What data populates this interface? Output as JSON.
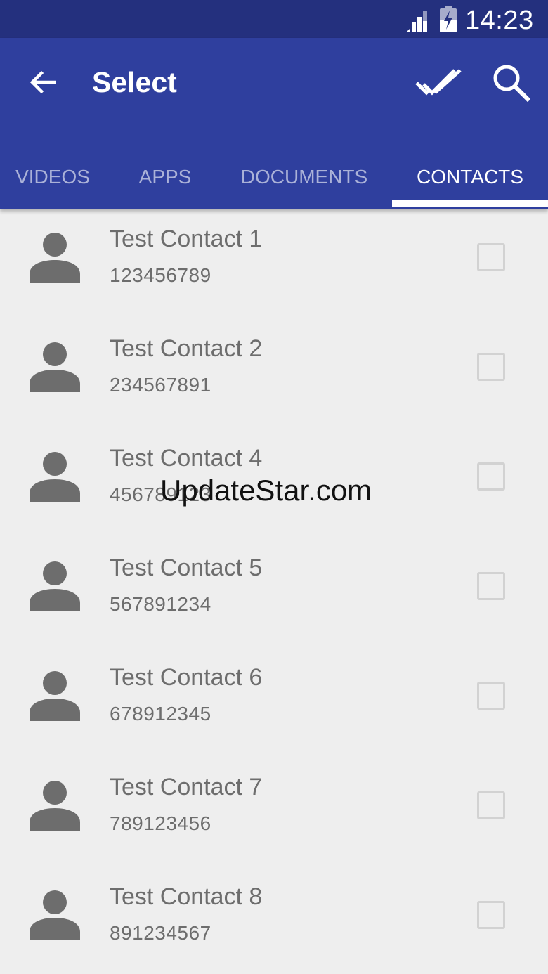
{
  "status_bar": {
    "time": "14:23",
    "icons": [
      "signal-icon",
      "battery-charging-icon"
    ]
  },
  "app_bar": {
    "title": "Select",
    "icons": [
      "back-arrow-icon",
      "select-all-icon",
      "search-icon"
    ]
  },
  "tabs": [
    {
      "label": "VIDEOS",
      "active": false
    },
    {
      "label": "APPS",
      "active": false
    },
    {
      "label": "DOCUMENTS",
      "active": false
    },
    {
      "label": "CONTACTS",
      "active": true
    }
  ],
  "contacts": [
    {
      "name": "Test Contact 1",
      "number": "123456789",
      "checked": false
    },
    {
      "name": "Test Contact 2",
      "number": "234567891",
      "checked": false
    },
    {
      "name": "Test Contact 4",
      "number": "456789123",
      "checked": false
    },
    {
      "name": "Test Contact 5",
      "number": "567891234",
      "checked": false
    },
    {
      "name": "Test Contact 6",
      "number": "678912345",
      "checked": false
    },
    {
      "name": "Test Contact 7",
      "number": "789123456",
      "checked": false
    },
    {
      "name": "Test Contact 8",
      "number": "891234567",
      "checked": false
    }
  ],
  "watermark": "UpdateStar.com",
  "colors": {
    "status_bar": "#24307e",
    "app_bar": "#2f3f9e",
    "background": "#eeeeee",
    "text_secondary": "#6d6d6d",
    "checkbox_border": "#d2d2d2"
  }
}
